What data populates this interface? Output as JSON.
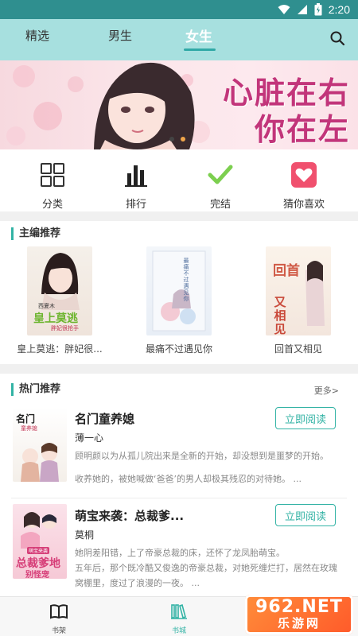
{
  "status_bar": {
    "time": "2:20",
    "icons": [
      "wifi-icon",
      "signal-icon",
      "battery-icon"
    ]
  },
  "top_tabs": [
    {
      "label": "精选",
      "active": false
    },
    {
      "label": "男生",
      "active": false
    },
    {
      "label": "女生",
      "active": true
    }
  ],
  "banner": {
    "line1": "心脏在右",
    "line2": "你在左",
    "page_count": 2,
    "current_page": 2
  },
  "quick_nav": [
    {
      "label": "分类",
      "icon": "grid-icon"
    },
    {
      "label": "排行",
      "icon": "bar-chart-icon"
    },
    {
      "label": "完结",
      "icon": "checkmark-icon"
    },
    {
      "label": "猜你喜欢",
      "icon": "heart-icon"
    }
  ],
  "editor_picks": {
    "title": "主编推荐",
    "books": [
      {
        "name": "皇上莫逃：胖妃很...",
        "cover_text_1": "西夏木",
        "cover_text_2": "皇上莫逃",
        "cover_text_3": "胖妃很抢手"
      },
      {
        "name": "最痛不过遇见你",
        "cover_text_1": "最痛不过遇见你"
      },
      {
        "name": "回首又相见",
        "cover_text_1": "回首",
        "cover_text_2": "又相见"
      }
    ]
  },
  "hot_picks": {
    "title": "热门推荐",
    "more_label": "更多>",
    "items": [
      {
        "title": "名门童养媳",
        "author": "薄一心",
        "desc_1": "顾明颜以为从孤儿院出来是全新的开始，却没想到是噩梦的开始。",
        "desc_2": "收养她的，被她喊做‘爸爸’的男人却极其残忍的对待她。 ...",
        "button_label": "立即阅读",
        "cover_text_1": "名门",
        "cover_text_2": "童养媳"
      },
      {
        "title": "萌宝来袭：总裁爹...",
        "author": "莫桐",
        "desc_1": "她阴差阳错，上了帝豪总裁的床，还怀了龙凤胎萌宝。",
        "desc_2": "五年后，那个既冷酷又俊逸的帝豪总裁，对她死缠烂打，居然在玫瑰窝棚里，度过了浪漫的一夜。 ...",
        "button_label": "立即阅读",
        "cover_text_1": "萌宝来袭",
        "cover_text_2": "总裁爹地",
        "cover_text_3": "别怪宠"
      }
    ]
  },
  "bottom_nav": [
    {
      "label": "书架",
      "icon": "book-open-icon",
      "active": false
    },
    {
      "label": "书城",
      "icon": "library-icon",
      "active": true
    }
  ],
  "watermark": {
    "line1": "962.NET",
    "line2": "乐游网"
  },
  "colors": {
    "accent": "#33b3a5",
    "top_bar": "#a7e0df",
    "status_bar": "#2f8f8f",
    "heart": "#f0506e",
    "check": "#7ccf4f"
  }
}
